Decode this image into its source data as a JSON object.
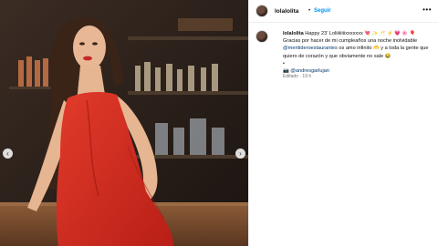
{
  "post": {
    "username": "lolalolita",
    "follow_label": "Seguir",
    "separator": "•",
    "more_label": "•••",
    "prev_label": "‹",
    "next_label": "›"
  },
  "caption": {
    "username": "lolalolita",
    "line1_text": "Happy 23’ Loliiiiiiiixxxxxxx",
    "line1_emojis": "💘 ✨ 🥂 ⚡ 💗 🌸 🎈",
    "line2": "Gracias por hacer de mi cumpleaños una noche inolvidable",
    "mention1": "@mentideroestaurantes",
    "line3_text": "os amo infinito",
    "line3_emoji1": "🫶",
    "line3_rest": "y a toda la gente que quiero de corazón y que obviamente no sale",
    "line3_emoji2": "😂",
    "bullet": "•",
    "camera_emoji": "📷",
    "mention2": "@andresgarlujan"
  },
  "meta": {
    "edited": "Editado",
    "separator": "·",
    "time": "19 h"
  }
}
